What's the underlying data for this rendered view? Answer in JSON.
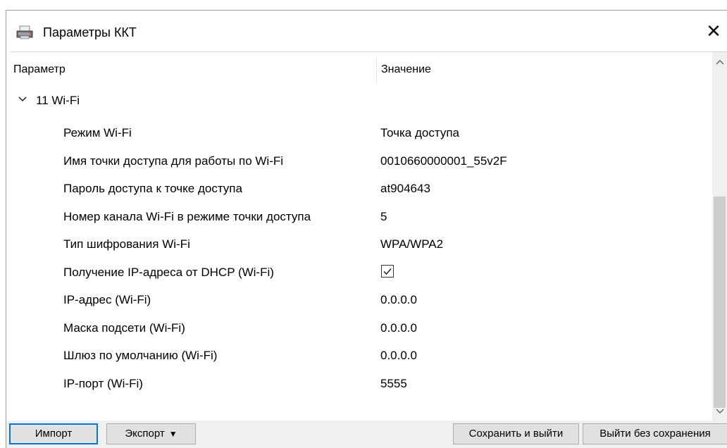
{
  "window": {
    "title": "Параметры ККТ",
    "close_glyph": "✕"
  },
  "columns": {
    "parameter": "Параметр",
    "value": "Значение"
  },
  "group": {
    "label": "11 Wi-Fi",
    "expanded": true
  },
  "rows": [
    {
      "parameter": "Режим Wi-Fi",
      "value": "Точка доступа"
    },
    {
      "parameter": "Имя точки доступа для работы по Wi-Fi",
      "value": "0010660000001_55v2F"
    },
    {
      "parameter": "Пароль доступа к точке доступа",
      "value": "at904643"
    },
    {
      "parameter": "Номер канала Wi-Fi в режиме точки доступа",
      "value": "5"
    },
    {
      "parameter": "Тип шифрования Wi-Fi",
      "value": "WPA/WPA2"
    },
    {
      "parameter": "Получение IP-адреса от DHCP (Wi-Fi)",
      "checked": true
    },
    {
      "parameter": "IP-адрес (Wi-Fi)",
      "value": "0.0.0.0"
    },
    {
      "parameter": "Маска подсети (Wi-Fi)",
      "value": "0.0.0.0"
    },
    {
      "parameter": "Шлюз по умолчанию (Wi-Fi)",
      "value": "0.0.0.0"
    },
    {
      "parameter": "IP-порт (Wi-Fi)",
      "value": "5555"
    }
  ],
  "buttons": {
    "import": "Импорт",
    "export": "Экспорт",
    "save_exit": "Сохранить и выйти",
    "exit_no_save": "Выйти без сохранения"
  },
  "icons": {
    "app": "printer-icon",
    "group_toggle": "chevron-down-icon",
    "scroll_up": "scroll-up-arrow-icon",
    "scroll_down": "scroll-down-arrow-icon",
    "export_menu": "caret-down-icon"
  },
  "colors": {
    "focus": "#0078d7",
    "button_face": "#e1e1e1",
    "footer_bg": "#f0f0f0"
  }
}
